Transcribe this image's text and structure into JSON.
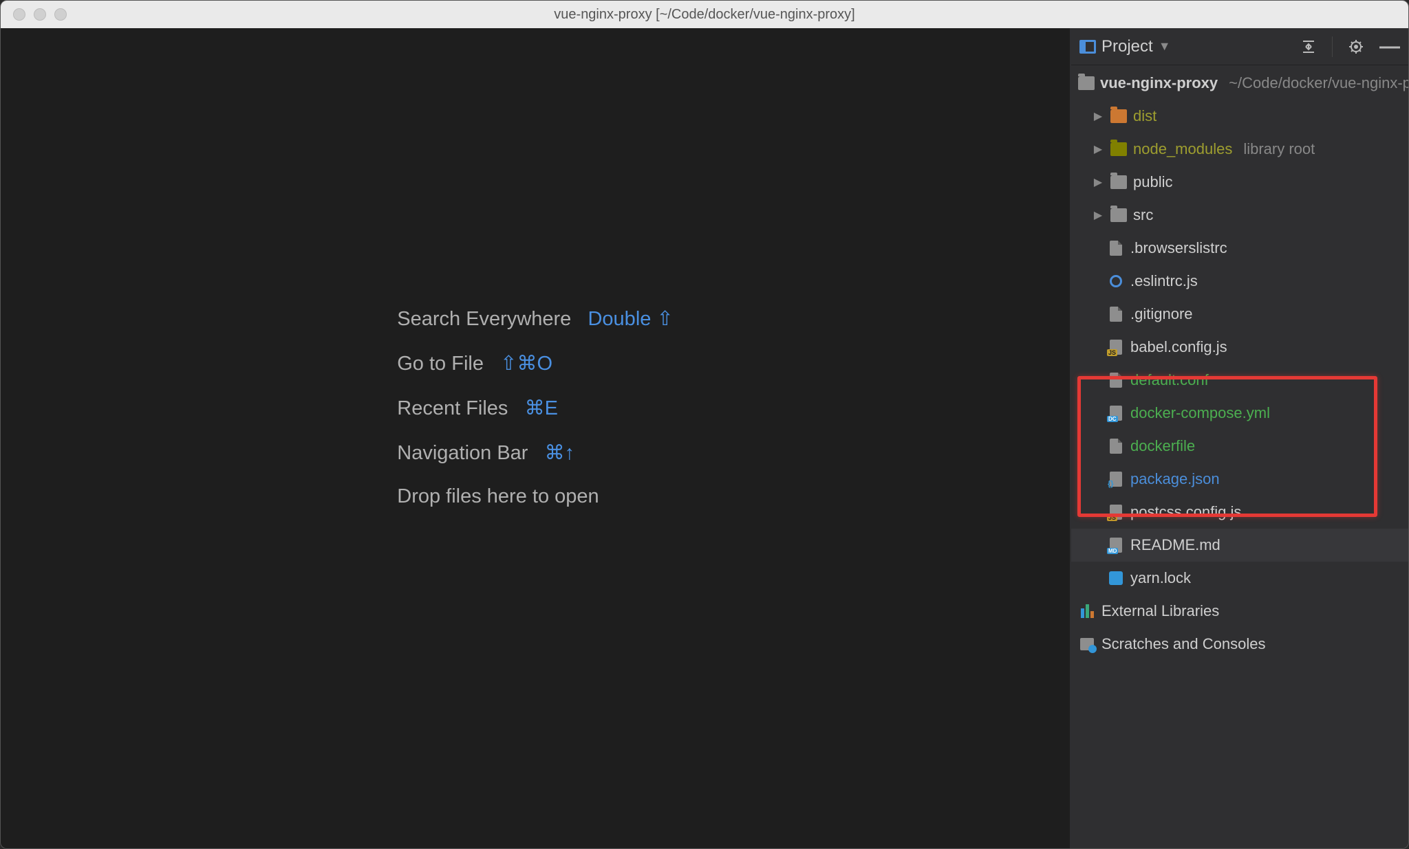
{
  "title": "vue-nginx-proxy [~/Code/docker/vue-nginx-proxy]",
  "empty": {
    "search_label": "Search Everywhere",
    "search_shortcut": "Double ⇧",
    "goto_label": "Go to File",
    "goto_shortcut": "⇧⌘O",
    "recent_label": "Recent Files",
    "recent_shortcut": "⌘E",
    "nav_label": "Navigation Bar",
    "nav_shortcut": "⌘↑",
    "drop_label": "Drop files here to open"
  },
  "panel": {
    "title": "Project"
  },
  "tree": {
    "root": "vue-nginx-proxy",
    "root_path": "~/Code/docker/vue-nginx-proxy",
    "dist": "dist",
    "node_modules": "node_modules",
    "node_modules_hint": "library root",
    "public": "public",
    "src": "src",
    "browserslistrc": ".browserslistrc",
    "eslintrc": ".eslintrc.js",
    "gitignore": ".gitignore",
    "babel": "babel.config.js",
    "default_conf": "default.conf",
    "docker_compose": "docker-compose.yml",
    "dockerfile": "dockerfile",
    "package_json": "package.json",
    "postcss": "postcss.config.js",
    "readme": "README.md",
    "yarn": "yarn.lock",
    "external": "External Libraries",
    "scratches": "Scratches and Consoles"
  }
}
